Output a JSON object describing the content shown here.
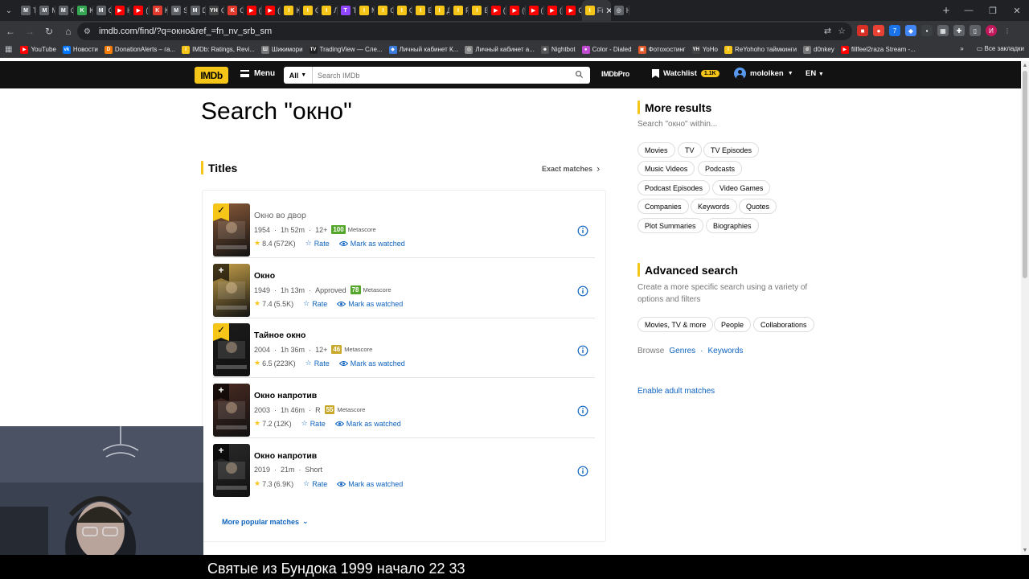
{
  "browser": {
    "tabs": [
      {
        "label": "Tv",
        "color": "#5f6368",
        "glyph": "M"
      },
      {
        "label": "M",
        "color": "#5f6368",
        "glyph": "M"
      },
      {
        "label": "Q",
        "color": "#5f6368",
        "glyph": "M"
      },
      {
        "label": "K",
        "color": "#34a853",
        "glyph": "K"
      },
      {
        "label": "Q",
        "color": "#5f6368",
        "glyph": "M"
      },
      {
        "label": "H",
        "color": "#ff0000",
        "glyph": "▶"
      },
      {
        "label": "(5",
        "color": "#ff0000",
        "glyph": "▶"
      },
      {
        "label": "K",
        "color": "#e23b2e",
        "glyph": "K"
      },
      {
        "label": "S",
        "color": "#5f6368",
        "glyph": "M"
      },
      {
        "label": "D",
        "color": "#5f6368",
        "glyph": "M"
      },
      {
        "label": "C",
        "color": "#444",
        "glyph": "YH"
      },
      {
        "label": "C",
        "color": "#e23b2e",
        "glyph": "K"
      },
      {
        "label": "(5",
        "color": "#ff0000",
        "glyph": "▶"
      },
      {
        "label": "(5",
        "color": "#ff0000",
        "glyph": "▶"
      },
      {
        "label": "K",
        "color": "#f5c518",
        "glyph": "I"
      },
      {
        "label": "C",
        "color": "#f5c518",
        "glyph": "I"
      },
      {
        "label": "Л",
        "color": "#f5c518",
        "glyph": "I"
      },
      {
        "label": "Tv",
        "color": "#9146ff",
        "glyph": "T"
      },
      {
        "label": "M",
        "color": "#f5c518",
        "glyph": "I"
      },
      {
        "label": "O",
        "color": "#f5c518",
        "glyph": "I"
      },
      {
        "label": "O",
        "color": "#f5c518",
        "glyph": "I"
      },
      {
        "label": "El",
        "color": "#f5c518",
        "glyph": "I"
      },
      {
        "label": "Д",
        "color": "#f5c518",
        "glyph": "I"
      },
      {
        "label": "Fi",
        "color": "#f5c518",
        "glyph": "I"
      },
      {
        "label": "Б",
        "color": "#f5c518",
        "glyph": "I"
      },
      {
        "label": "(5",
        "color": "#ff0000",
        "glyph": "▶"
      },
      {
        "label": "(5",
        "color": "#ff0000",
        "glyph": "▶"
      },
      {
        "label": "(5",
        "color": "#ff0000",
        "glyph": "▶"
      },
      {
        "label": "(5",
        "color": "#ff0000",
        "glyph": "▶"
      },
      {
        "label": "C",
        "color": "#ff0000",
        "glyph": "▶"
      }
    ],
    "active_tab": {
      "label": "Fi",
      "color": "#f5c518",
      "glyph": "I"
    },
    "tab_after_active": {
      "label": "H",
      "color": "#5f6368",
      "glyph": "◎"
    },
    "url": "imdb.com/find/?q=окно&ref_=fn_nv_srb_sm",
    "bookmarks": [
      {
        "label": "YouTube",
        "color": "#ff0000",
        "glyph": "▶"
      },
      {
        "label": "Новости",
        "color": "#0077ff",
        "glyph": "vk"
      },
      {
        "label": "DonationAlerts – га...",
        "color": "#f57d07",
        "glyph": "D"
      },
      {
        "label": "IMDb: Ratings, Revi...",
        "color": "#f5c518",
        "glyph": "I"
      },
      {
        "label": "Шикимори",
        "color": "#777",
        "glyph": "Ш"
      },
      {
        "label": "TradingView — Сле...",
        "color": "#222",
        "glyph": "TV"
      },
      {
        "label": "Личный кабинет К...",
        "color": "#3b7ddd",
        "glyph": "◆"
      },
      {
        "label": "Личный кабинет а...",
        "color": "#888",
        "glyph": "◎"
      },
      {
        "label": "Nightbot",
        "color": "#555",
        "glyph": "☻"
      },
      {
        "label": "Color - Dialed",
        "color": "#c04ad0",
        "glyph": "●"
      },
      {
        "label": "Фотохостинг",
        "color": "#e05a2b",
        "glyph": "▣"
      },
      {
        "label": "YoHo",
        "color": "#444",
        "glyph": "YH"
      },
      {
        "label": "ReYohoho таймкинги",
        "color": "#f5c518",
        "glyph": "I"
      },
      {
        "label": "d0nkey",
        "color": "#777",
        "glyph": "d"
      },
      {
        "label": "fillfeel2raza Stream -...",
        "color": "#ff0000",
        "glyph": "▶"
      }
    ],
    "bookmarks_end": "Все закладки"
  },
  "imdb": {
    "logo": "IMDb",
    "menu_label": "Menu",
    "search_category": "All",
    "search_placeholder": "Search IMDb",
    "pro_label": "IMDbPro",
    "watchlist_label": "Watchlist",
    "watchlist_count": "1.1K",
    "username": "mololken",
    "language": "EN"
  },
  "main": {
    "title": "Search \"окно\"",
    "titles_heading": "Titles",
    "exact_matches": "Exact matches",
    "more_popular": "More popular matches",
    "results": [
      {
        "title": "Окно во двор",
        "year": "1954",
        "runtime": "1h 52m",
        "cert": "12+",
        "metascore": "100",
        "ms_color": "#54a72a",
        "ms_label": "Metascore",
        "rating": "8.4",
        "votes": "(572K)",
        "rate": "Rate",
        "mark": "Mark as watched",
        "in_watchlist": true,
        "poster_color": "#8a5a3a"
      },
      {
        "title": "Окно",
        "year": "1949",
        "runtime": "1h 13m",
        "cert": "Approved",
        "metascore": "78",
        "ms_color": "#54a72a",
        "ms_label": "Metascore",
        "rating": "7.4",
        "votes": "(5.5K)",
        "rate": "Rate",
        "mark": "Mark as watched",
        "in_watchlist": false,
        "poster_color": "#c8a24a"
      },
      {
        "title": "Тайное окно",
        "year": "2004",
        "runtime": "1h 36m",
        "cert": "12+",
        "metascore": "46",
        "ms_color": "#c9a92b",
        "ms_label": "Metascore",
        "rating": "6.5",
        "votes": "(223K)",
        "rate": "Rate",
        "mark": "Mark as watched",
        "in_watchlist": true,
        "poster_color": "#1b1b1b"
      },
      {
        "title": "Окно напротив",
        "year": "2003",
        "runtime": "1h 46m",
        "cert": "R",
        "metascore": "55",
        "ms_color": "#c9a92b",
        "ms_label": "Metascore",
        "rating": "7.2",
        "votes": "(12K)",
        "rate": "Rate",
        "mark": "Mark as watched",
        "in_watchlist": false,
        "poster_color": "#4a2a22"
      },
      {
        "title": "Окно напротив",
        "year": "2019",
        "runtime": "21m",
        "cert": "Short",
        "metascore": "",
        "ms_color": "",
        "ms_label": "",
        "rating": "7.3",
        "votes": "(6.9K)",
        "rate": "Rate",
        "mark": "Mark as watched",
        "in_watchlist": false,
        "poster_color": "#2a2a2a"
      }
    ]
  },
  "sidebar": {
    "more_results_heading": "More results",
    "more_results_sub": "Search \"окно\" within...",
    "chips": [
      "Movies",
      "TV",
      "TV Episodes",
      "Music Videos",
      "Podcasts",
      "Podcast Episodes",
      "Video Games",
      "Companies",
      "Keywords",
      "Quotes",
      "Plot Summaries",
      "Biographies"
    ],
    "advanced_heading": "Advanced search",
    "advanced_sub": "Create a more specific search using a variety of options and filters",
    "advanced_chips": [
      "Movies, TV & more",
      "People",
      "Collaborations"
    ],
    "browse_label": "Browse",
    "browse_genres": "Genres",
    "browse_keywords": "Keywords",
    "adult_link": "Enable adult matches"
  },
  "stream": {
    "caption": "Святые из Бундока 1999 начало 22 33"
  }
}
